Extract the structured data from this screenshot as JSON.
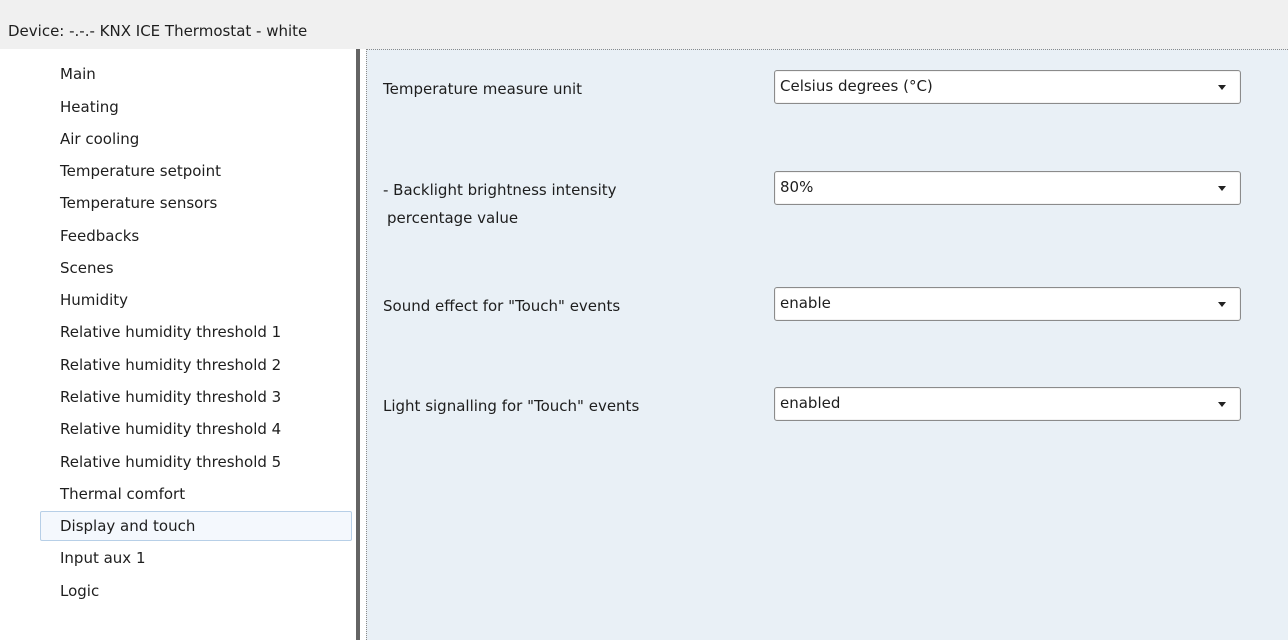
{
  "window": {
    "title": "Device: -.-.-  KNX ICE Thermostat - white"
  },
  "nav": {
    "items": [
      {
        "label": "Main"
      },
      {
        "label": "Heating"
      },
      {
        "label": "Air cooling"
      },
      {
        "label": "Temperature setpoint"
      },
      {
        "label": "Temperature sensors"
      },
      {
        "label": "Feedbacks"
      },
      {
        "label": "Scenes"
      },
      {
        "label": "Humidity"
      },
      {
        "label": "Relative humidity threshold 1"
      },
      {
        "label": "Relative humidity threshold 2"
      },
      {
        "label": "Relative humidity threshold 3"
      },
      {
        "label": "Relative humidity threshold 4"
      },
      {
        "label": "Relative humidity threshold 5"
      },
      {
        "label": "Thermal comfort"
      },
      {
        "label": "Display and touch"
      },
      {
        "label": "Input aux 1"
      },
      {
        "label": "Logic"
      }
    ],
    "selected": "Display and touch"
  },
  "params": {
    "temp_unit": {
      "label": "Temperature measure unit",
      "value": "Celsius degrees (°C)"
    },
    "backlight": {
      "label_line1": "- Backlight brightness intensity",
      "label_line2": "percentage value",
      "value": "80%"
    },
    "sound": {
      "label": "Sound effect for \"Touch\" events",
      "value": "enable"
    },
    "light": {
      "label": "Light signalling for \"Touch\" events",
      "value": "enabled"
    }
  }
}
